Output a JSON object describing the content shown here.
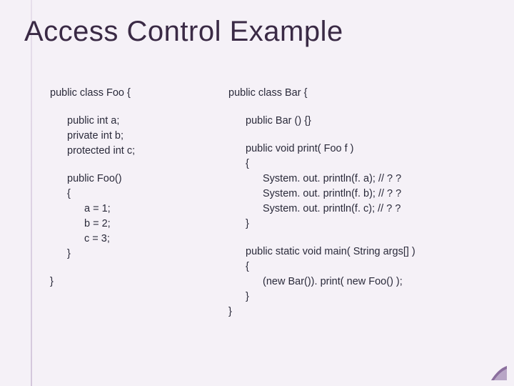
{
  "title": "Access Control Example",
  "left": {
    "l0": "public class Foo {",
    "l1": "public int a;",
    "l2": "private int b;",
    "l3": "protected int c;",
    "l4": "public Foo()",
    "l5": "{",
    "l6": "a = 1;",
    "l7": "b = 2;",
    "l8": "c = 3;",
    "l9": "}",
    "l10": "}"
  },
  "right": {
    "r0": "public class Bar {",
    "r1": "public Bar () {}",
    "r2": "public void print( Foo f )",
    "r3": "{",
    "r4": "System. out. println(f. a); // ? ?",
    "r5": "System. out. println(f. b); // ? ?",
    "r6": "System. out. println(f. c); // ? ?",
    "r7": "}",
    "r8": "public static void main( String args[] )",
    "r9": "{",
    "r10": "(new Bar()). print( new Foo() );",
    "r11": "}",
    "r12": "}"
  }
}
